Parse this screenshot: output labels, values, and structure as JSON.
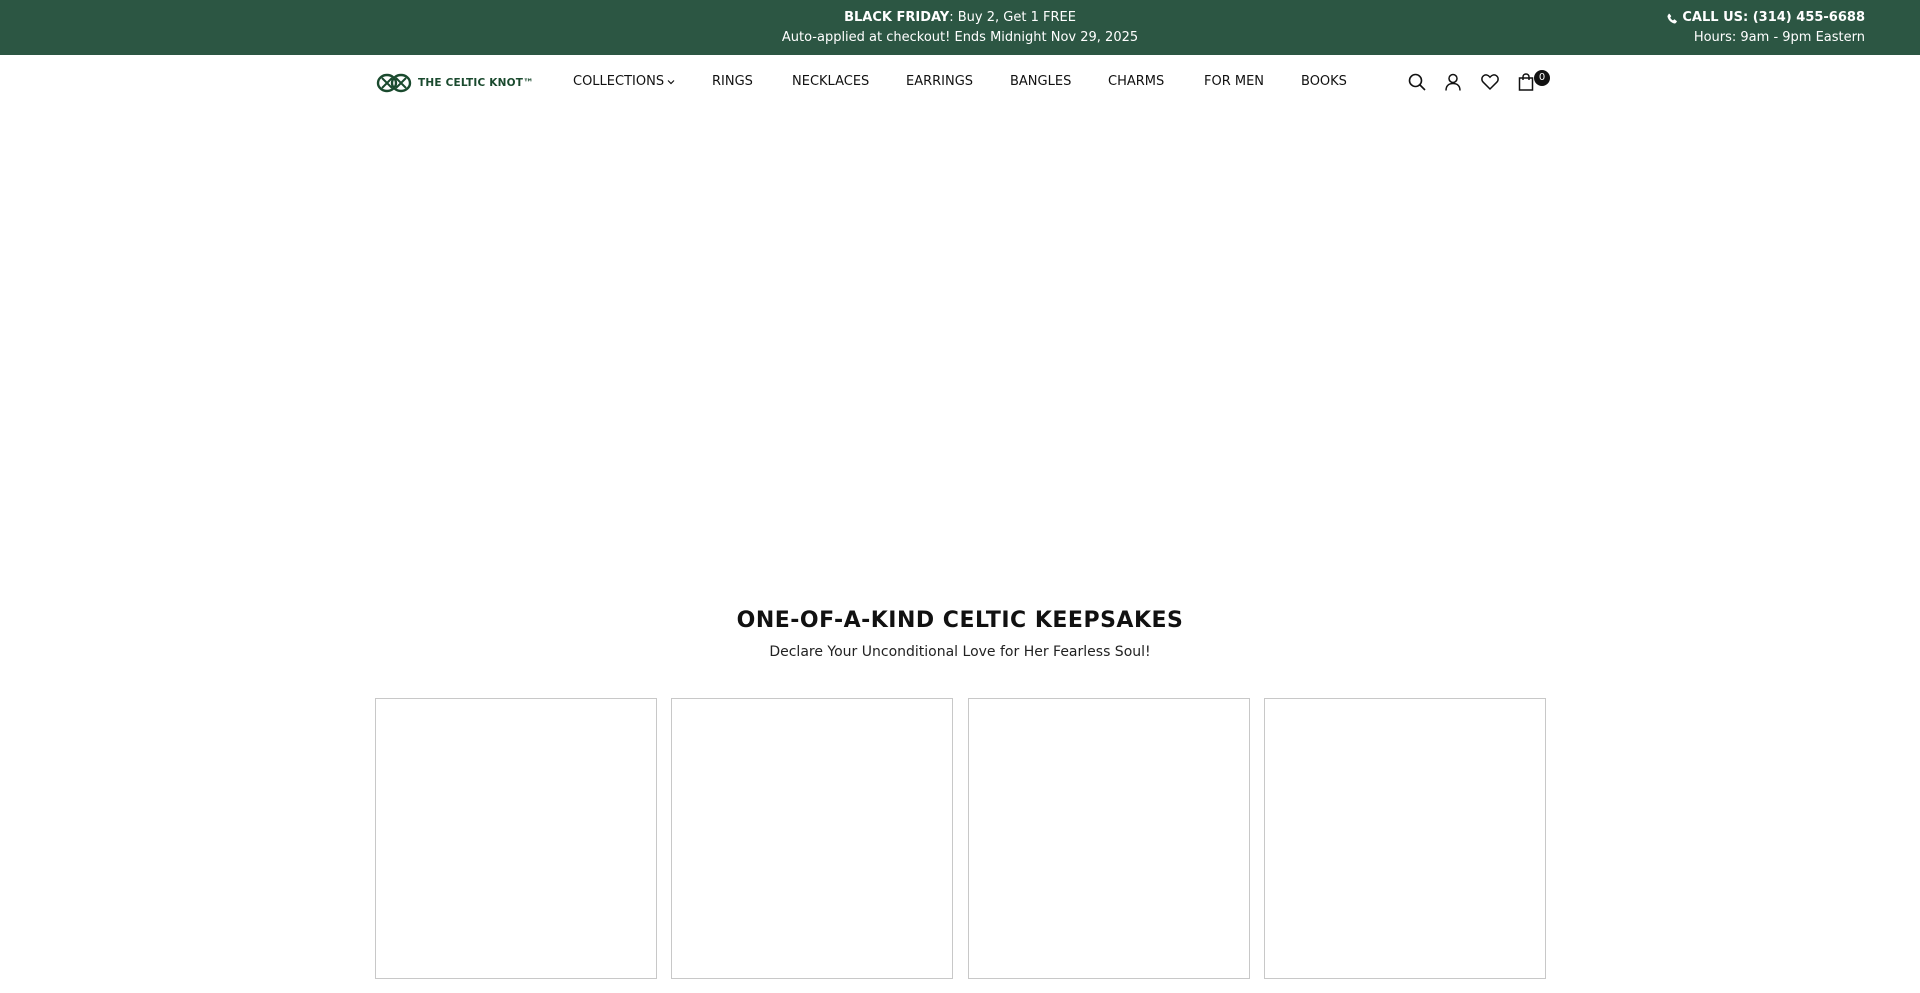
{
  "announcement": {
    "promo_bold": "BLACK FRIDAY",
    "promo_rest": ": Buy 2, Get 1 FREE",
    "promo_line2": "Auto-applied at checkout! Ends Midnight Nov 29, 2025",
    "call_label": "CALL US: (314) 455-6688",
    "hours": "Hours: 9am - 9pm Eastern",
    "phone_icon": "phone-icon"
  },
  "header": {
    "logo_text": "THE CELTIC KNOT™",
    "nav": [
      {
        "label": "COLLECTIONS",
        "has_dropdown": true
      },
      {
        "label": "RINGS"
      },
      {
        "label": "NECKLACES"
      },
      {
        "label": "EARRINGS"
      },
      {
        "label": "BANGLES"
      },
      {
        "label": "CHARMS"
      },
      {
        "label": "FOR MEN"
      },
      {
        "label": "BOOKS"
      }
    ],
    "icons": [
      "search-icon",
      "account-icon",
      "heart-icon",
      "cart-icon"
    ],
    "cart_count": "0"
  },
  "section": {
    "title": "ONE-OF-A-KIND CELTIC KEEPSAKES",
    "subtitle": "Declare Your Unconditional Love for Her Fearless Soul!"
  },
  "colors": {
    "announcement_bg": "#2c5643",
    "brand_green": "#1a4a2e",
    "card_border": "#c8c8c8"
  }
}
